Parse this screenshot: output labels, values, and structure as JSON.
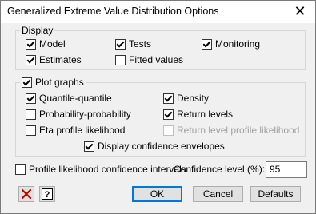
{
  "window": {
    "title": "Generalized Extreme Value Distribution Options",
    "close_glyph": "✕"
  },
  "display": {
    "label": "Display",
    "model": {
      "label": "Model",
      "checked": true
    },
    "tests": {
      "label": "Tests",
      "checked": true
    },
    "monitoring": {
      "label": "Monitoring",
      "checked": true
    },
    "estimates": {
      "label": "Estimates",
      "checked": true
    },
    "fitted_values": {
      "label": "Fitted values",
      "checked": false
    }
  },
  "plot_graphs": {
    "label": "Plot graphs",
    "checked": true,
    "quantile_quantile": {
      "label": "Quantile-quantile",
      "checked": true
    },
    "density": {
      "label": "Density",
      "checked": true
    },
    "probability_probability": {
      "label": "Probability-probability",
      "checked": false
    },
    "return_levels": {
      "label": "Return levels",
      "checked": true
    },
    "eta_profile_likelihood": {
      "label": "Eta profile likelihood",
      "checked": false
    },
    "return_level_profile_likelihood": {
      "label": "Return level profile likelihood",
      "checked": false,
      "disabled": true
    },
    "display_confidence_envelopes": {
      "label": "Display confidence envelopes",
      "checked": true
    }
  },
  "profile_likelihood_ci": {
    "label": "Profile likelihood confidence intervals",
    "checked": false
  },
  "confidence_level": {
    "label": "Confidence level (%):",
    "value": "95"
  },
  "buttons": {
    "ok": "OK",
    "cancel": "Cancel",
    "defaults": "Defaults"
  },
  "icons": {
    "clear": "clear-x-icon",
    "help": "help-question-icon",
    "clear_color": "#c00000"
  }
}
